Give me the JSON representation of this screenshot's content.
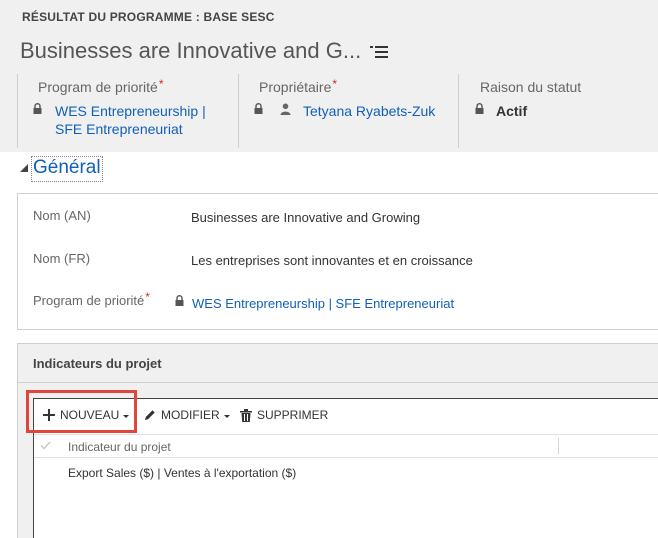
{
  "header": {
    "entity_type": "RÉSULTAT DU PROGRAMME : BASE SESC",
    "record_title": "Businesses are Innovative and G...",
    "fields": {
      "priority": {
        "label": "Program de priorité",
        "required": "*",
        "link_line1": "WES Entrepreneurship |",
        "link_line2": "SFE Entrepreneuriat"
      },
      "owner": {
        "label": "Propriétaire",
        "required": "*",
        "value": "Tetyana Ryabets-Zuk"
      },
      "status": {
        "label": "Raison du statut",
        "value": "Actif"
      }
    }
  },
  "section": {
    "title": "Général",
    "fields": {
      "name_en": {
        "label": "Nom (AN)",
        "value": "Businesses are Innovative and Growing"
      },
      "name_fr": {
        "label": "Nom (FR)",
        "value": "Les entreprises sont innovantes et en croissance"
      },
      "priority": {
        "label": "Program de priorité",
        "required": "*",
        "value": "WES Entrepreneurship | SFE Entrepreneuriat"
      }
    }
  },
  "subgrid": {
    "title": "Indicateurs du projet",
    "commands": {
      "new": "NOUVEAU",
      "edit": "MODIFIER",
      "delete": "SUPPRIMER"
    },
    "column_header": "Indicateur du projet",
    "rows": [
      "Export Sales ($) | Ventes à l'exportation ($)"
    ]
  },
  "colors": {
    "link": "#1160b7",
    "required": "#d9252a",
    "highlight": "#e0463b",
    "header_bg": "#f0f0f0"
  },
  "icons": [
    "menu-icon",
    "lock-icon",
    "user-icon",
    "collapse-triangle-icon",
    "plus-icon",
    "pencil-icon",
    "trash-icon",
    "check-icon"
  ]
}
